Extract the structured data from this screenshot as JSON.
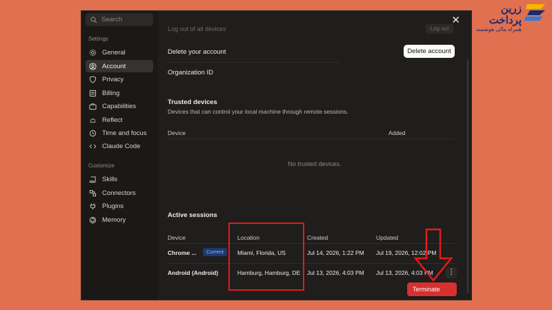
{
  "brand": {
    "name": "زرین پرداخت",
    "tagline": "همراه مالی هوشمند"
  },
  "sidebar": {
    "search_placeholder": "Search",
    "settings_label": "Settings",
    "customize_label": "Customize",
    "settings_items": [
      {
        "label": "General",
        "icon": "gear-icon"
      },
      {
        "label": "Account",
        "icon": "user-icon",
        "active": true
      },
      {
        "label": "Privacy",
        "icon": "shield-icon"
      },
      {
        "label": "Billing",
        "icon": "card-icon"
      },
      {
        "label": "Capabilities",
        "icon": "briefcase-icon"
      },
      {
        "label": "Reflect",
        "icon": "reflect-icon"
      },
      {
        "label": "Time and focus",
        "icon": "clock-icon"
      },
      {
        "label": "Claude Code",
        "icon": "code-icon"
      }
    ],
    "customize_items": [
      {
        "label": "Skills",
        "icon": "scroll-icon"
      },
      {
        "label": "Connectors",
        "icon": "connectors-icon"
      },
      {
        "label": "Plugins",
        "icon": "plug-icon"
      },
      {
        "label": "Memory",
        "icon": "memory-icon"
      }
    ]
  },
  "main": {
    "cut_row_label": "Log out of all devices",
    "cut_row_button": "Log out",
    "delete_account_label": "Delete your account",
    "delete_account_button": "Delete account",
    "org_id_label": "Organization ID",
    "trusted_devices": {
      "title": "Trusted devices",
      "description": "Devices that can control your local machine through remote sessions.",
      "col_device": "Device",
      "col_added": "Added",
      "empty_text": "No trusted devices."
    },
    "active_sessions": {
      "title": "Active sessions",
      "col_device": "Device",
      "col_location": "Location",
      "col_created": "Created",
      "col_updated": "Updated",
      "current_badge": "Current",
      "rows": [
        {
          "device": "Chrome ...",
          "location": "Miami, Florida, US",
          "created": "Jul 14, 2026, 1:22 PM",
          "updated": "Jul 19, 2026, 12:02 PM"
        },
        {
          "device": "Android (Android)",
          "location": "Hamburg, Hamburg, DE",
          "created": "Jul 13, 2026, 4:03 PM",
          "updated": "Jul 13, 2026, 4:03 PM"
        }
      ]
    },
    "terminate_label": "Terminate"
  },
  "colors": {
    "background": "#e0704f",
    "panel": "#1f1e1d",
    "highlight": "#e41b1b",
    "terminate": "#d6302f"
  }
}
